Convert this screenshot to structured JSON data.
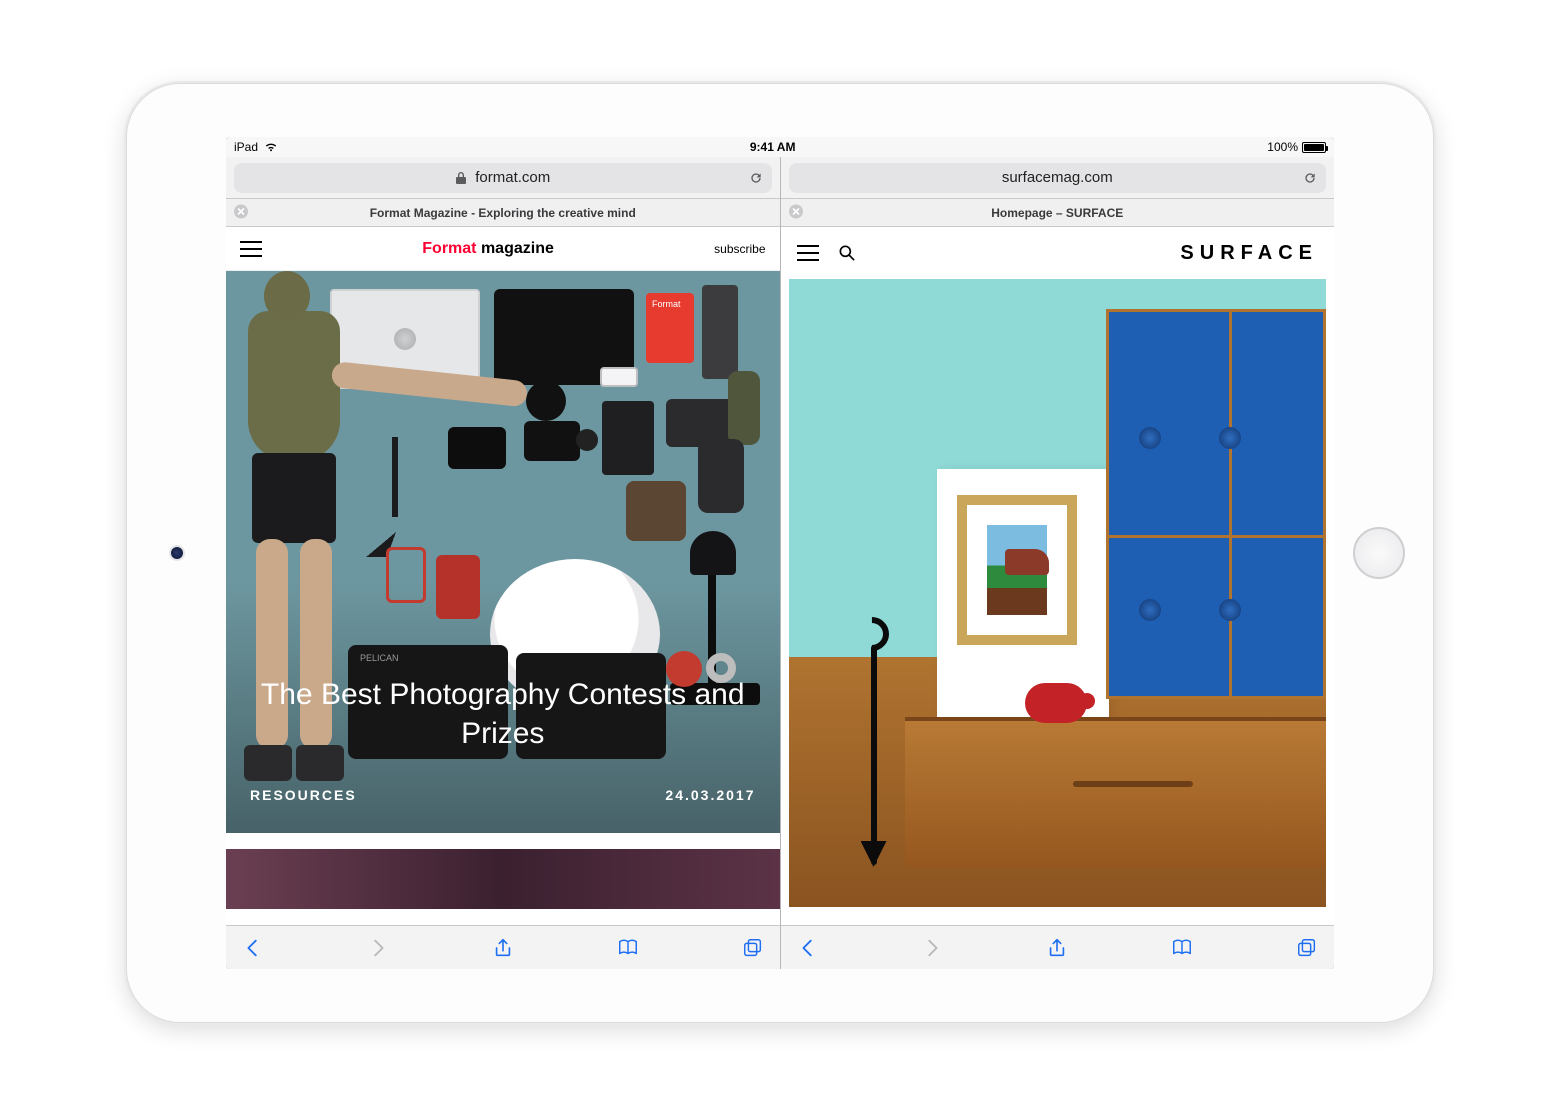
{
  "statusbar": {
    "carrier": "iPad",
    "time": "9:41 AM",
    "battery_pct": "100%"
  },
  "panes": {
    "left": {
      "url": "format.com",
      "secure": true,
      "tab_title": "Format Magazine - Exploring the creative mind",
      "site": {
        "logo_brand": "Format",
        "logo_word": "magazine",
        "subscribe_label": "subscribe",
        "article_title": "The Best Photography Contests and Prizes",
        "category": "RESOURCES",
        "date": "24.03.2017"
      }
    },
    "right": {
      "url": "surfacemag.com",
      "secure": false,
      "tab_title": "Homepage – SURFACE",
      "site": {
        "logo": "SURFACE"
      }
    }
  }
}
